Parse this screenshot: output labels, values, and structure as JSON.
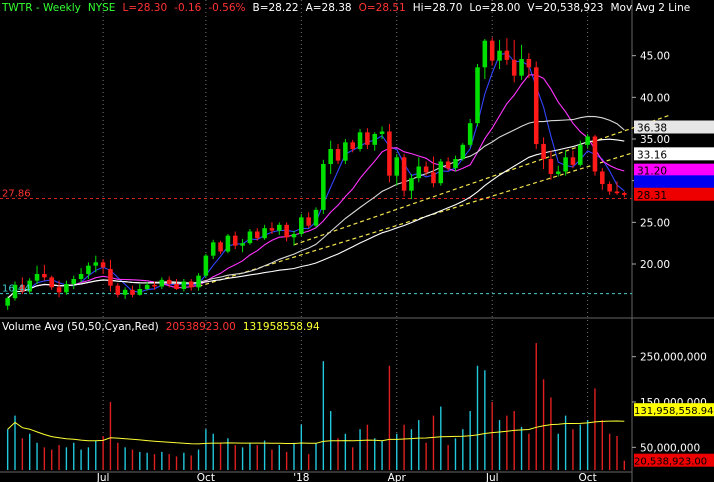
{
  "header": {
    "symbol": "TWTR - Weekly",
    "exchange": "NYSE",
    "last": "L=28.30",
    "change": "-0.16",
    "change_pct": "-0.56%",
    "bid": "B=28.22",
    "ask": "A=28.38",
    "open": "O=28.51",
    "high": "Hi=28.70",
    "low": "Lo=28.00",
    "volume": "V=20,538,923",
    "ma_label": "Mov Avg 2 Line"
  },
  "volume_header": {
    "title": "Volume Avg (50,50,Cyan,Red)",
    "value1": "20538923.00",
    "value2": "131958558.94"
  },
  "colors": {
    "up": "#00e000",
    "down": "#ff1a1a",
    "ma_blue": "#3344ff",
    "ma_magenta": "#ff33ff",
    "ma_white": "#ffffff",
    "ma_lightgray": "#d8d8d8",
    "trend": "#f2e44a",
    "vol_up": "#22c8dc",
    "vol_down": "#e02020",
    "vol_avg": "#ffff33",
    "support": "#44cccc",
    "hline": "#d02020"
  },
  "chart_data": {
    "type": "candlestick",
    "price_axis": {
      "ylim": [
        14,
        50
      ],
      "ticks": [
        20,
        25,
        30,
        35,
        40,
        45
      ],
      "tick_labels": [
        "20.00",
        "25.00",
        "30.00",
        "35.00",
        "40.00",
        "45.00"
      ]
    },
    "volume_axis": {
      "ylim": [
        0,
        300000000
      ],
      "ticks": [
        50000000,
        150000000,
        250000000
      ],
      "tick_labels": [
        "50,000,000",
        "150,000,000",
        "250,000,000"
      ]
    },
    "x_labels": [
      {
        "index": 13,
        "label": "Jul"
      },
      {
        "index": 27,
        "label": "Oct"
      },
      {
        "index": 40,
        "label": "'18"
      },
      {
        "index": 53,
        "label": "Apr"
      },
      {
        "index": 66,
        "label": "Jul"
      },
      {
        "index": 79,
        "label": "Oct"
      }
    ],
    "price_badges": [
      {
        "value": 36.38,
        "label": "36.38",
        "bg": "#e6e6e6",
        "fg": "#000000"
      },
      {
        "value": 33.16,
        "label": "33.16",
        "bg": "#ffffff",
        "fg": "#000000"
      },
      {
        "value": 31.2,
        "label": "31.20",
        "bg": "#ff00ff",
        "fg": "#000000"
      },
      {
        "value": 29.8,
        "label": "",
        "bg": "#0000ee",
        "fg": "#ffffff"
      },
      {
        "value": 28.31,
        "label": "28.31",
        "bg": "#ee0000",
        "fg": "#000000"
      }
    ],
    "volume_badges": [
      {
        "value": 131958558.94,
        "label": "131,958,558.94",
        "bg": "#ffff00",
        "fg": "#000000"
      },
      {
        "value": 20538923,
        "label": "20,538,923.00",
        "bg": "#ee0000",
        "fg": "#000000"
      }
    ],
    "left_annotations": [
      {
        "value": 27.86,
        "label": "27.86",
        "color": "#ff3333"
      },
      {
        "value": 16.44,
        "label": "16.44",
        "color": "#44cccc"
      }
    ],
    "candles": [
      {
        "o": 15.0,
        "h": 16.1,
        "l": 14.5,
        "c": 15.9,
        "v": 90000000
      },
      {
        "o": 15.9,
        "h": 17.9,
        "l": 15.6,
        "c": 17.5,
        "v": 120000000
      },
      {
        "o": 17.5,
        "h": 18.4,
        "l": 16.4,
        "c": 16.7,
        "v": 70000000
      },
      {
        "o": 16.7,
        "h": 18.3,
        "l": 16.4,
        "c": 18.0,
        "v": 80000000
      },
      {
        "o": 18.0,
        "h": 19.8,
        "l": 17.6,
        "c": 18.8,
        "v": 60000000
      },
      {
        "o": 18.8,
        "h": 19.9,
        "l": 18.0,
        "c": 18.4,
        "v": 50000000
      },
      {
        "o": 18.4,
        "h": 18.6,
        "l": 16.9,
        "c": 17.2,
        "v": 45000000
      },
      {
        "o": 17.2,
        "h": 18.0,
        "l": 16.0,
        "c": 16.6,
        "v": 55000000
      },
      {
        "o": 16.6,
        "h": 18.0,
        "l": 16.3,
        "c": 17.6,
        "v": 50000000
      },
      {
        "o": 17.6,
        "h": 18.6,
        "l": 17.0,
        "c": 18.2,
        "v": 60000000
      },
      {
        "o": 18.2,
        "h": 19.5,
        "l": 17.8,
        "c": 18.8,
        "v": 45000000
      },
      {
        "o": 18.8,
        "h": 20.2,
        "l": 18.2,
        "c": 19.8,
        "v": 50000000
      },
      {
        "o": 19.8,
        "h": 21.0,
        "l": 19.0,
        "c": 20.2,
        "v": 65000000
      },
      {
        "o": 20.2,
        "h": 20.6,
        "l": 18.8,
        "c": 19.6,
        "v": 75000000
      },
      {
        "o": 19.4,
        "h": 20.5,
        "l": 16.7,
        "c": 17.4,
        "v": 150000000
      },
      {
        "o": 17.4,
        "h": 17.7,
        "l": 16.0,
        "c": 16.3,
        "v": 60000000
      },
      {
        "o": 16.3,
        "h": 17.2,
        "l": 15.8,
        "c": 16.9,
        "v": 50000000
      },
      {
        "o": 16.9,
        "h": 17.4,
        "l": 16.0,
        "c": 16.3,
        "v": 45000000
      },
      {
        "o": 16.3,
        "h": 17.6,
        "l": 16.2,
        "c": 17.0,
        "v": 40000000
      },
      {
        "o": 17.0,
        "h": 17.8,
        "l": 16.8,
        "c": 17.5,
        "v": 38000000
      },
      {
        "o": 17.5,
        "h": 17.9,
        "l": 16.9,
        "c": 17.3,
        "v": 35000000
      },
      {
        "o": 17.3,
        "h": 18.4,
        "l": 17.0,
        "c": 18.1,
        "v": 40000000
      },
      {
        "o": 18.1,
        "h": 18.5,
        "l": 17.2,
        "c": 17.6,
        "v": 35000000
      },
      {
        "o": 17.6,
        "h": 18.2,
        "l": 16.9,
        "c": 17.0,
        "v": 30000000
      },
      {
        "o": 17.0,
        "h": 18.2,
        "l": 16.7,
        "c": 17.9,
        "v": 38000000
      },
      {
        "o": 17.9,
        "h": 18.2,
        "l": 16.8,
        "c": 17.2,
        "v": 32000000
      },
      {
        "o": 17.2,
        "h": 18.9,
        "l": 16.8,
        "c": 18.6,
        "v": 45000000
      },
      {
        "o": 18.6,
        "h": 21.2,
        "l": 18.3,
        "c": 21.0,
        "v": 90000000
      },
      {
        "o": 21.0,
        "h": 22.9,
        "l": 20.6,
        "c": 22.6,
        "v": 80000000
      },
      {
        "o": 22.6,
        "h": 22.8,
        "l": 21.2,
        "c": 21.5,
        "v": 60000000
      },
      {
        "o": 21.5,
        "h": 23.6,
        "l": 21.3,
        "c": 23.4,
        "v": 70000000
      },
      {
        "o": 23.4,
        "h": 23.9,
        "l": 21.8,
        "c": 22.2,
        "v": 55000000
      },
      {
        "o": 22.2,
        "h": 23.0,
        "l": 21.4,
        "c": 22.5,
        "v": 50000000
      },
      {
        "o": 22.5,
        "h": 24.2,
        "l": 22.3,
        "c": 23.9,
        "v": 60000000
      },
      {
        "o": 23.9,
        "h": 24.3,
        "l": 22.8,
        "c": 23.1,
        "v": 55000000
      },
      {
        "o": 23.1,
        "h": 24.7,
        "l": 22.9,
        "c": 24.3,
        "v": 65000000
      },
      {
        "o": 24.3,
        "h": 25.0,
        "l": 23.6,
        "c": 24.0,
        "v": 45000000
      },
      {
        "o": 24.0,
        "h": 25.0,
        "l": 23.5,
        "c": 24.7,
        "v": 55000000
      },
      {
        "o": 24.7,
        "h": 25.0,
        "l": 22.7,
        "c": 23.2,
        "v": 40000000
      },
      {
        "o": 23.2,
        "h": 24.0,
        "l": 22.2,
        "c": 23.6,
        "v": 60000000
      },
      {
        "o": 23.6,
        "h": 26.0,
        "l": 23.3,
        "c": 25.6,
        "v": 100000000
      },
      {
        "o": 25.6,
        "h": 26.2,
        "l": 24.3,
        "c": 24.6,
        "v": 35000000
      },
      {
        "o": 24.6,
        "h": 26.8,
        "l": 24.4,
        "c": 26.5,
        "v": 60000000
      },
      {
        "o": 26.5,
        "h": 32.5,
        "l": 26.0,
        "c": 32.0,
        "v": 240000000
      },
      {
        "o": 32.0,
        "h": 34.8,
        "l": 30.8,
        "c": 33.8,
        "v": 130000000
      },
      {
        "o": 33.8,
        "h": 34.4,
        "l": 32.0,
        "c": 32.4,
        "v": 70000000
      },
      {
        "o": 32.4,
        "h": 35.0,
        "l": 32.0,
        "c": 34.6,
        "v": 80000000
      },
      {
        "o": 34.6,
        "h": 34.9,
        "l": 33.4,
        "c": 33.8,
        "v": 50000000
      },
      {
        "o": 33.8,
        "h": 36.2,
        "l": 33.5,
        "c": 35.8,
        "v": 90000000
      },
      {
        "o": 35.8,
        "h": 36.3,
        "l": 33.8,
        "c": 34.3,
        "v": 100000000
      },
      {
        "o": 34.3,
        "h": 35.8,
        "l": 33.6,
        "c": 35.6,
        "v": 70000000
      },
      {
        "o": 35.6,
        "h": 36.5,
        "l": 35.0,
        "c": 35.9,
        "v": 65000000
      },
      {
        "o": 35.9,
        "h": 36.8,
        "l": 29.8,
        "c": 30.6,
        "v": 230000000
      },
      {
        "o": 30.6,
        "h": 33.2,
        "l": 29.4,
        "c": 32.8,
        "v": 80000000
      },
      {
        "o": 32.8,
        "h": 33.2,
        "l": 28.1,
        "c": 28.8,
        "v": 100000000
      },
      {
        "o": 28.8,
        "h": 30.8,
        "l": 27.8,
        "c": 30.3,
        "v": 90000000
      },
      {
        "o": 30.3,
        "h": 32.8,
        "l": 29.8,
        "c": 31.7,
        "v": 110000000
      },
      {
        "o": 31.7,
        "h": 32.3,
        "l": 30.6,
        "c": 31.0,
        "v": 60000000
      },
      {
        "o": 31.0,
        "h": 32.9,
        "l": 29.2,
        "c": 29.7,
        "v": 120000000
      },
      {
        "o": 29.7,
        "h": 32.6,
        "l": 29.4,
        "c": 32.3,
        "v": 140000000
      },
      {
        "o": 32.3,
        "h": 32.8,
        "l": 31.2,
        "c": 31.5,
        "v": 55000000
      },
      {
        "o": 31.5,
        "h": 33.0,
        "l": 31.1,
        "c": 32.6,
        "v": 70000000
      },
      {
        "o": 32.6,
        "h": 34.5,
        "l": 32.4,
        "c": 34.3,
        "v": 90000000
      },
      {
        "o": 34.3,
        "h": 37.4,
        "l": 34.0,
        "c": 36.9,
        "v": 130000000
      },
      {
        "o": 36.9,
        "h": 44.0,
        "l": 36.5,
        "c": 43.6,
        "v": 230000000
      },
      {
        "o": 43.6,
        "h": 47.0,
        "l": 42.2,
        "c": 46.8,
        "v": 220000000
      },
      {
        "o": 46.8,
        "h": 47.2,
        "l": 43.8,
        "c": 44.4,
        "v": 150000000
      },
      {
        "o": 44.4,
        "h": 46.9,
        "l": 43.4,
        "c": 45.6,
        "v": 110000000
      },
      {
        "o": 45.6,
        "h": 47.1,
        "l": 43.9,
        "c": 44.5,
        "v": 120000000
      },
      {
        "o": 44.5,
        "h": 46.9,
        "l": 41.8,
        "c": 42.6,
        "v": 130000000
      },
      {
        "o": 42.6,
        "h": 46.3,
        "l": 42.1,
        "c": 44.6,
        "v": 95000000
      },
      {
        "o": 44.6,
        "h": 45.3,
        "l": 42.3,
        "c": 43.6,
        "v": 80000000
      },
      {
        "o": 43.6,
        "h": 44.3,
        "l": 33.8,
        "c": 34.4,
        "v": 280000000
      },
      {
        "o": 34.4,
        "h": 35.2,
        "l": 31.4,
        "c": 32.6,
        "v": 200000000
      },
      {
        "o": 32.6,
        "h": 33.6,
        "l": 30.1,
        "c": 30.8,
        "v": 160000000
      },
      {
        "o": 30.8,
        "h": 31.8,
        "l": 30.5,
        "c": 31.1,
        "v": 80000000
      },
      {
        "o": 31.1,
        "h": 33.6,
        "l": 30.6,
        "c": 32.8,
        "v": 120000000
      },
      {
        "o": 32.8,
        "h": 33.6,
        "l": 31.5,
        "c": 31.9,
        "v": 90000000
      },
      {
        "o": 31.9,
        "h": 34.8,
        "l": 31.7,
        "c": 34.3,
        "v": 100000000
      },
      {
        "o": 34.3,
        "h": 35.6,
        "l": 33.9,
        "c": 35.3,
        "v": 110000000
      },
      {
        "o": 35.3,
        "h": 35.5,
        "l": 30.6,
        "c": 31.1,
        "v": 180000000
      },
      {
        "o": 31.1,
        "h": 31.5,
        "l": 28.9,
        "c": 29.6,
        "v": 110000000
      },
      {
        "o": 29.6,
        "h": 29.9,
        "l": 28.3,
        "c": 28.7,
        "v": 80000000
      },
      {
        "o": 28.7,
        "h": 29.9,
        "l": 28.3,
        "c": 28.5,
        "v": 75000000
      },
      {
        "o": 28.51,
        "h": 28.7,
        "l": 28.0,
        "c": 28.3,
        "v": 20538923
      }
    ],
    "moving_averages": [
      {
        "color_key": "ma_blue",
        "period": 4
      },
      {
        "color_key": "ma_magenta",
        "period": 10
      },
      {
        "color_key": "ma_lightgray",
        "period": 20
      },
      {
        "color_key": "ma_white",
        "period": 40
      }
    ],
    "volume_average_period": 50,
    "trendlines": [
      {
        "from": [
          26,
          17.3
        ],
        "to": [
          85,
          33.3
        ]
      },
      {
        "from": [
          39,
          22.3
        ],
        "to": [
          90,
          37.8
        ]
      }
    ],
    "horizontal_lines": [
      {
        "value": 27.86,
        "color_key": "hline",
        "dash": true
      },
      {
        "value": 16.44,
        "color_key": "support",
        "dash": true
      }
    ]
  }
}
